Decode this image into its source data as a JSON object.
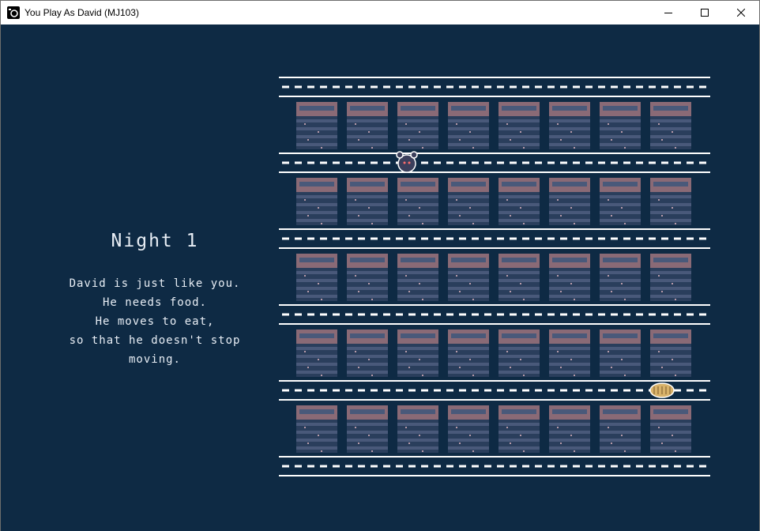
{
  "window": {
    "title": "You Play As David (MJ103)",
    "app_icon": "camera-icon",
    "controls": [
      "minimize-icon",
      "maximize-icon",
      "close-icon"
    ]
  },
  "story": {
    "night_title": "Night 1",
    "lines": [
      "David is just like you.",
      "He needs food.",
      "He moves to eat,",
      "so that he doesn't stop",
      "moving."
    ]
  },
  "game": {
    "shelf_rows": 5,
    "shelves_per_row": 8,
    "aisles": 6,
    "player": {
      "name": "David",
      "icon": "mouse-icon",
      "aisle": 2,
      "column": 2
    },
    "food": {
      "icon": "bread-icon",
      "aisle": 5,
      "column": 7
    }
  },
  "colors": {
    "background": "#0e2a44",
    "line": "#ffffff",
    "shelf_top": "#8a6a76",
    "shelf_stripe_dark": "#2a3e5c",
    "shelf_stripe_light": "#49597a",
    "food": "#d8b26a"
  }
}
